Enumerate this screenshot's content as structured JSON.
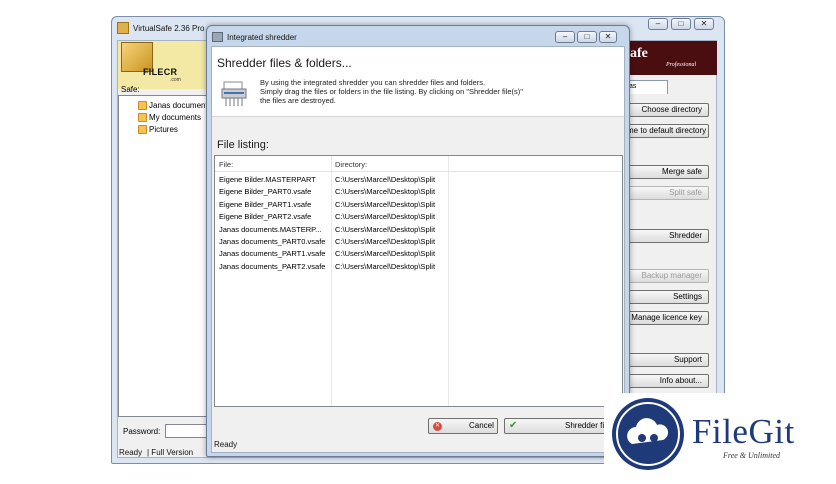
{
  "main_window": {
    "title": "VirtualSafe 2.36 Pro",
    "safe_label": "Safe:",
    "tree": [
      "Janas documents",
      "My documents",
      "Pictures"
    ],
    "logo_text": "FILECR",
    "logo_sub": ".com",
    "brand_text": "afe",
    "brand_sub": "Professional",
    "tab_fragment": "as",
    "buttons": {
      "choose_directory": "Choose directory",
      "default_directory": "me to default directory",
      "merge_safe": "Merge safe",
      "split_safe": "Split safe",
      "shredder": "Shredder",
      "backup_manager": "Backup manager",
      "settings": "Settings",
      "manage_licence": "Manage licence key",
      "support": "Support",
      "info_about": "Info about..."
    },
    "password_label": "Password:",
    "status_ready": "Ready",
    "status_version": "| Full Version"
  },
  "dialog": {
    "title": "Integrated shredder",
    "heading": "Shredder files & folders...",
    "description": [
      "By using the integrated shredder you can shredder files and folders.",
      "Simply drag the files or folders in the file listing. By clicking on \"Shredder file(s)\"",
      "the files are destroyed."
    ],
    "listing_label": "File listing:",
    "columns": [
      "File:",
      "Directory:"
    ],
    "files": [
      {
        "file": "Eigene Bilder.MASTERPART",
        "dir": "C:\\Users\\Marcel\\Desktop\\Split"
      },
      {
        "file": "Eigene Bilder_PART0.vsafe",
        "dir": "C:\\Users\\Marcel\\Desktop\\Split"
      },
      {
        "file": "Eigene Bilder_PART1.vsafe",
        "dir": "C:\\Users\\Marcel\\Desktop\\Split"
      },
      {
        "file": "Eigene Bilder_PART2.vsafe",
        "dir": "C:\\Users\\Marcel\\Desktop\\Split"
      },
      {
        "file": "Janas documents.MASTERP...",
        "dir": "C:\\Users\\Marcel\\Desktop\\Split"
      },
      {
        "file": "Janas documents_PART0.vsafe",
        "dir": "C:\\Users\\Marcel\\Desktop\\Split"
      },
      {
        "file": "Janas documents_PART1.vsafe",
        "dir": "C:\\Users\\Marcel\\Desktop\\Split"
      },
      {
        "file": "Janas documents_PART2.vsafe",
        "dir": "C:\\Users\\Marcel\\Desktop\\Split"
      }
    ],
    "cancel_label": "Cancel",
    "shredder_label": "Shredder fil",
    "status": "Ready"
  },
  "watermark": {
    "name": "FileGit",
    "tagline": "Free & Unlimited"
  },
  "colors": {
    "window_frame": "#dce6f2",
    "dialog_frame": "#c6d7ec",
    "brand_bg": "#4a0e10",
    "filegit_blue": "#1e3a78"
  }
}
